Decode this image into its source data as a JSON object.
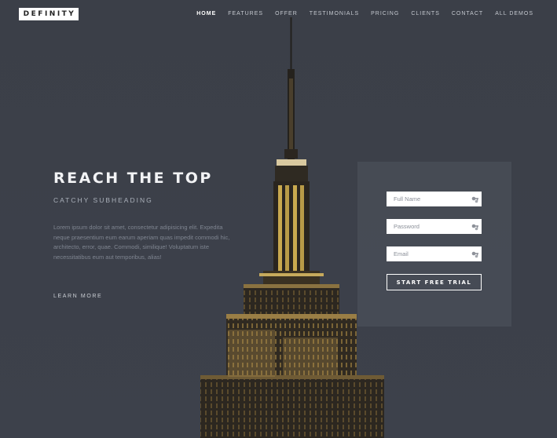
{
  "brand": {
    "logo_text": "DEFINITY"
  },
  "nav": {
    "items": [
      {
        "label": "HOME",
        "active": true
      },
      {
        "label": "FEATURES"
      },
      {
        "label": "OFFER"
      },
      {
        "label": "TESTIMONIALS"
      },
      {
        "label": "PRICING"
      },
      {
        "label": "CLIENTS"
      },
      {
        "label": "CONTACT"
      },
      {
        "label": "ALL DEMOS"
      }
    ]
  },
  "hero": {
    "title": "REACH THE TOP",
    "subtitle": "CATCHY SUBHEADING",
    "body": "Lorem ipsum dolor sit amet, consectetur adipisicing elit. Expedita neque praesentium eum earum aperiam quas impedit commodi hic, architecto, error, quae. Commodi, similique! Voluptatum iste necessitatibus eum aut temporibus, alias!",
    "cta_label": "LEARN MORE"
  },
  "signup_form": {
    "full_name_placeholder": "Full Name",
    "password_placeholder": "Password",
    "email_placeholder": "Email",
    "submit_label": "START FREE TRIAL"
  },
  "colors": {
    "background": "#3c4049",
    "panel": "#484c56",
    "nav_text": "#c4c8cf",
    "building_light": "#e8c66b"
  }
}
